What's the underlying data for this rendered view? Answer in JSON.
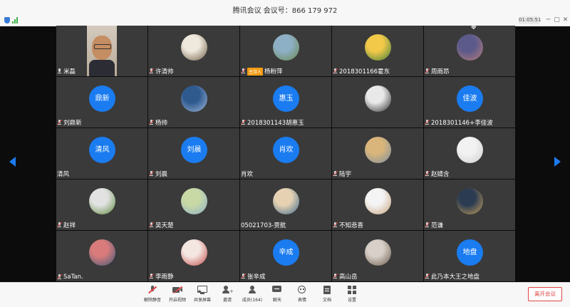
{
  "window": {
    "title": "腾讯会议  会议号：866 179 972",
    "timer": "01:05:51"
  },
  "participants": [
    {
      "name": "米磊",
      "type": "video",
      "mic": "on"
    },
    {
      "name": "许清帅",
      "type": "photo",
      "mic": "off",
      "avatar_colors": [
        "#efe8dc",
        "#6e5c45"
      ]
    },
    {
      "name": "杨粉萍",
      "type": "photo",
      "mic": "off",
      "host_badge": "主持人",
      "avatar_colors": [
        "#8db0c7",
        "#6b8a4d"
      ]
    },
    {
      "name": "2018301166霍东",
      "type": "photo",
      "mic": "off",
      "avatar_colors": [
        "#f3c94a",
        "#3f7f3a"
      ]
    },
    {
      "name": "周雨昂",
      "type": "photo",
      "mic": "off",
      "avatar_colors": [
        "#5b5a8a",
        "#b87d7a"
      ]
    },
    {
      "name": "刘鼎新",
      "type": "text",
      "avatar_text": "鼎新",
      "mic": "off"
    },
    {
      "name": "杨帅",
      "type": "photo",
      "mic": "off",
      "avatar_colors": [
        "#2f5a8e",
        "#9fb7d9"
      ]
    },
    {
      "name": "2018301143胡惠玉",
      "type": "text",
      "avatar_text": "惠玉",
      "mic": "off"
    },
    {
      "name": "",
      "type": "photo",
      "mic": "none",
      "avatar_colors": [
        "#e9e9e9",
        "#2d2d2d"
      ]
    },
    {
      "name": "2018301146+李佳波",
      "type": "text",
      "avatar_text": "佳波",
      "mic": "off"
    },
    {
      "name": "清风",
      "type": "text",
      "avatar_text": "清风",
      "mic": "none"
    },
    {
      "name": "刘晨",
      "type": "text",
      "avatar_text": "刘晨",
      "mic": "off"
    },
    {
      "name": "肖欢",
      "type": "text",
      "avatar_text": "肖欢",
      "mic": "none"
    },
    {
      "name": "陆宇",
      "type": "photo",
      "mic": "off",
      "avatar_colors": [
        "#d9b57b",
        "#7a8fa1"
      ]
    },
    {
      "name": "赵婧含",
      "type": "photo",
      "mic": "off",
      "avatar_colors": [
        "#f2f2f2",
        "#cfcfcf"
      ]
    },
    {
      "name": "赵祥",
      "type": "photo",
      "mic": "off",
      "avatar_colors": [
        "#e2e2e2",
        "#5f8b3f"
      ]
    },
    {
      "name": "吴天楚",
      "type": "photo",
      "mic": "off",
      "avatar_colors": [
        "#c9d9a6",
        "#8ab0c8"
      ]
    },
    {
      "name": "05021703-贾航",
      "type": "photo",
      "mic": "none",
      "avatar_colors": [
        "#e6d2b2",
        "#3d6a8f"
      ]
    },
    {
      "name": "不知悲喜",
      "type": "photo",
      "mic": "off",
      "avatar_colors": [
        "#f4f4f4",
        "#c8a27a"
      ]
    },
    {
      "name": "范谦",
      "type": "photo",
      "mic": "off",
      "avatar_colors": [
        "#2b3b52",
        "#c9a15a"
      ]
    },
    {
      "name": "SaTan.",
      "type": "photo",
      "mic": "off",
      "avatar_colors": [
        "#d97b7b",
        "#3a5a7a"
      ]
    },
    {
      "name": "李雨静",
      "type": "photo",
      "mic": "off",
      "avatar_colors": [
        "#f4e6e0",
        "#c04a4a"
      ]
    },
    {
      "name": "张辛成",
      "type": "text",
      "avatar_text": "辛成",
      "mic": "off"
    },
    {
      "name": "高山岳",
      "type": "photo",
      "mic": "off",
      "avatar_colors": [
        "#d8d0c8",
        "#6a5a4a"
      ]
    },
    {
      "name": "此乃本大王之地盘",
      "type": "text",
      "avatar_text": "地盘",
      "mic": "off"
    }
  ],
  "toolbar": {
    "items": [
      {
        "label": "解除静音",
        "icon": "mic-muted-icon"
      },
      {
        "label": "开启视频",
        "icon": "video-off-icon"
      },
      {
        "label": "共享屏幕",
        "icon": "share-screen-icon"
      },
      {
        "label": "邀请",
        "icon": "invite-icon"
      },
      {
        "label": "成员(164)",
        "icon": "members-icon"
      },
      {
        "label": "聊天",
        "icon": "chat-icon"
      },
      {
        "label": "表情",
        "icon": "emoji-icon"
      },
      {
        "label": "文档",
        "icon": "document-icon"
      },
      {
        "label": "设置",
        "icon": "settings-icon"
      }
    ],
    "leave_label": "离开会议"
  },
  "colors": {
    "accent": "#1a7cf0",
    "danger": "#e24545",
    "tile": "#3a3a3a",
    "host_badge": "#f39c12"
  }
}
